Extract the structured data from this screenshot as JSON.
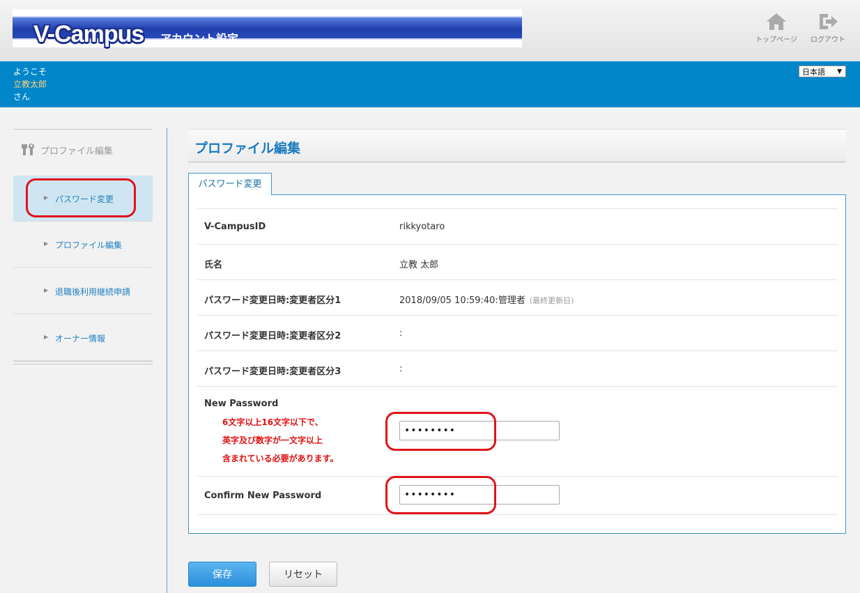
{
  "header": {
    "logo_text": "V-Campus",
    "logo_subtitle": "アカウント設定",
    "top_page_label": "トップページ",
    "logout_label": "ログアウト"
  },
  "user_bar": {
    "greeting": "ようこそ",
    "user_name": "立教太郎",
    "suffix": "さん",
    "language": "日本語"
  },
  "sidebar": {
    "heading": "プロファイル編集",
    "items": [
      {
        "label": "パスワード変更",
        "active": true
      },
      {
        "label": "プロファイル編集"
      },
      {
        "label": "退職後利用継続申請"
      },
      {
        "label": "オーナー情報"
      }
    ]
  },
  "main": {
    "title": "プロファイル編集",
    "tab_label": "パスワード変更",
    "rows": [
      {
        "label": "V-CampusID",
        "value": "rikkyotaro"
      },
      {
        "label": "氏名",
        "value": "立教 太郎"
      },
      {
        "label": "パスワード変更日時:変更者区分1",
        "value": "2018/09/05 10:59:40:管理者",
        "note": "(最終更新日)"
      },
      {
        "label": "パスワード変更日時:変更者区分2",
        "value": ":"
      },
      {
        "label": "パスワード変更日時:変更者区分3",
        "value": ":"
      }
    ],
    "new_password": {
      "label": "New Password",
      "value": "••••••••",
      "hint_lines": [
        "6文字以上16文字以下で、",
        "英字及び数字が一文字以上",
        "含まれている必要があります。"
      ]
    },
    "confirm_password": {
      "label": "Confirm New Password",
      "value": "••••••••"
    }
  },
  "actions": {
    "save_label": "保存",
    "reset_label": "リセット"
  },
  "colors": {
    "blue_bar": "#0086c9",
    "annotation_red": "#e0121a"
  }
}
